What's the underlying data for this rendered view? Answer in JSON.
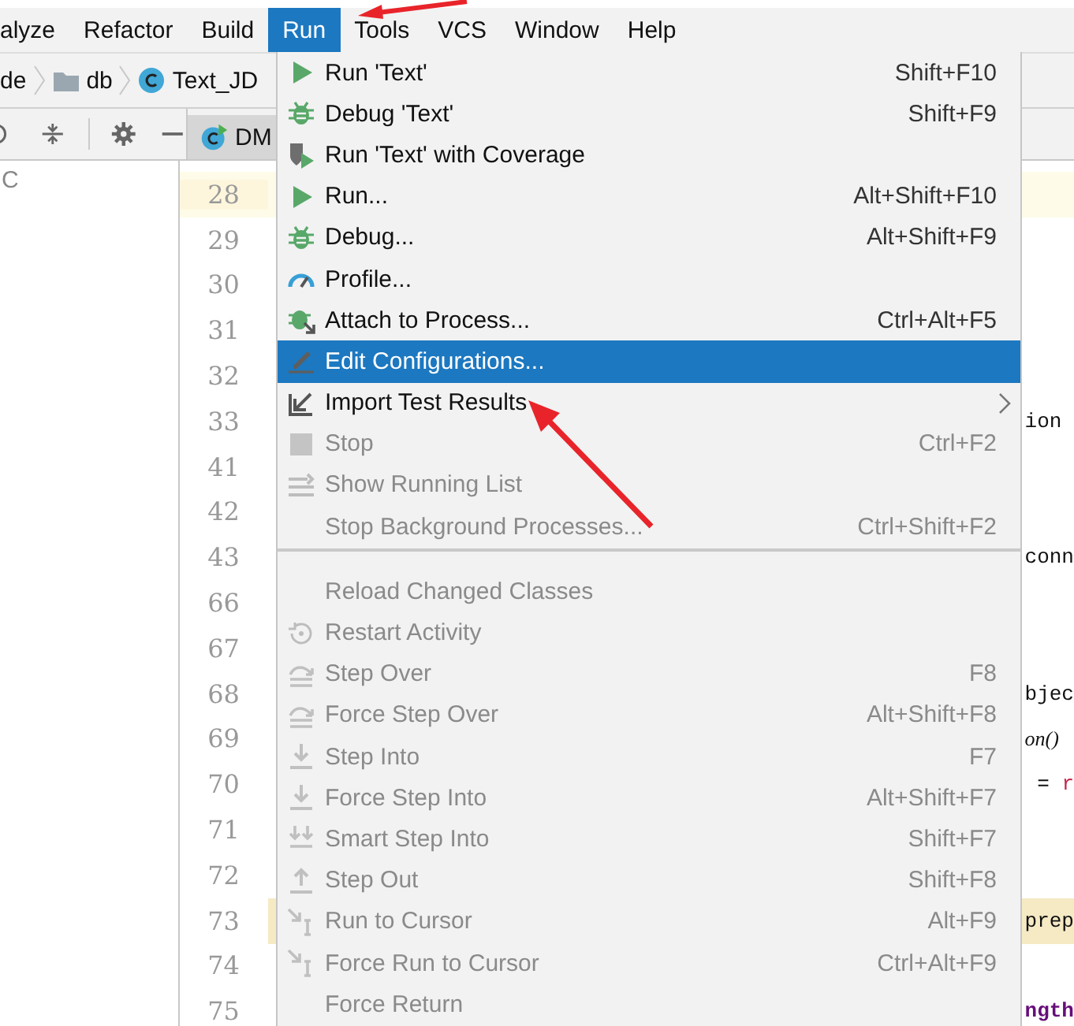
{
  "menubar": [
    {
      "label": "alyze",
      "selected": false
    },
    {
      "label": "Refactor",
      "selected": false
    },
    {
      "label": "Build",
      "selected": false
    },
    {
      "label": "Run",
      "selected": true
    },
    {
      "label": "Tools",
      "selected": false
    },
    {
      "label": "VCS",
      "selected": false
    },
    {
      "label": "Window",
      "selected": false
    },
    {
      "label": "Help",
      "selected": false
    }
  ],
  "breadcrumb": [
    {
      "label": "de",
      "kind": "text"
    },
    {
      "label": "db",
      "kind": "folder"
    },
    {
      "label": "Text_JD",
      "kind": "class"
    }
  ],
  "editor_tab": {
    "label": "DM"
  },
  "project_panel": {
    "label": "C"
  },
  "lines": [
    {
      "number": "28",
      "current": true,
      "highlighted": false
    },
    {
      "number": "29",
      "current": false,
      "highlighted": false
    },
    {
      "number": "30",
      "current": false,
      "highlighted": false
    },
    {
      "number": "31",
      "current": false,
      "highlighted": false
    },
    {
      "number": "32",
      "current": false,
      "highlighted": false
    },
    {
      "number": "33",
      "current": false,
      "highlighted": false,
      "segments": [
        {
          "text": "ion",
          "kind": "plain"
        }
      ]
    },
    {
      "number": "41",
      "current": false,
      "highlighted": false
    },
    {
      "number": "42",
      "current": false,
      "highlighted": false
    },
    {
      "number": "43",
      "current": false,
      "highlighted": false,
      "segments": [
        {
          "text": "conn",
          "kind": "plain"
        }
      ]
    },
    {
      "number": "66",
      "current": false,
      "highlighted": false
    },
    {
      "number": "67",
      "current": false,
      "highlighted": false
    },
    {
      "number": "68",
      "current": false,
      "highlighted": false,
      "segments": [
        {
          "text": "bjec",
          "kind": "plain"
        }
      ]
    },
    {
      "number": "69",
      "current": false,
      "highlighted": false,
      "segments": [
        {
          "text": "on()",
          "kind": "method"
        }
      ]
    },
    {
      "number": "70",
      "current": false,
      "highlighted": false,
      "segments": [
        {
          "text": " = ",
          "kind": "plain"
        },
        {
          "text": "r",
          "kind": "keyword"
        }
      ]
    },
    {
      "number": "71",
      "current": false,
      "highlighted": false
    },
    {
      "number": "72",
      "current": false,
      "highlighted": false
    },
    {
      "number": "73",
      "current": false,
      "highlighted": true,
      "segments": [
        {
          "text": "prep",
          "kind": "plain"
        }
      ]
    },
    {
      "number": "74",
      "current": false,
      "highlighted": false
    },
    {
      "number": "75",
      "current": false,
      "highlighted": false,
      "segments": [
        {
          "text": "ngth",
          "kind": "field"
        }
      ]
    }
  ],
  "menu": {
    "items": [
      {
        "kind": "action",
        "label": "Run 'Text'",
        "shortcut": "Shift+F10",
        "disabled": false,
        "selected": false
      },
      {
        "kind": "action",
        "label": "Debug 'Text'",
        "shortcut": "Shift+F9",
        "disabled": false,
        "selected": false
      },
      {
        "kind": "action",
        "label": "Run 'Text' with Coverage",
        "disabled": false,
        "selected": false
      },
      {
        "kind": "action",
        "label": "Run...",
        "shortcut": "Alt+Shift+F10",
        "disabled": false,
        "selected": false
      },
      {
        "kind": "action",
        "label": "Debug...",
        "shortcut": "Alt+Shift+F9",
        "disabled": false,
        "selected": false
      },
      {
        "kind": "action",
        "label": "Profile...",
        "disabled": false,
        "selected": false
      },
      {
        "kind": "action",
        "label": "Attach to Process...",
        "shortcut": "Ctrl+Alt+F5",
        "disabled": false,
        "selected": false
      },
      {
        "kind": "action",
        "label": "Edit Configurations...",
        "disabled": false,
        "selected": true
      },
      {
        "kind": "submenu",
        "label": "Import Test Results",
        "disabled": false,
        "selected": false
      },
      {
        "kind": "action",
        "label": "Stop",
        "shortcut": "Ctrl+F2",
        "disabled": true,
        "selected": false
      },
      {
        "kind": "action",
        "label": "Show Running List",
        "disabled": true,
        "selected": false
      },
      {
        "kind": "action",
        "label": "Stop Background Processes...",
        "shortcut": "Ctrl+Shift+F2",
        "disabled": true,
        "selected": false
      },
      {
        "kind": "separator"
      },
      {
        "kind": "action",
        "label": "Reload Changed Classes",
        "disabled": true,
        "selected": false
      },
      {
        "kind": "action",
        "label": "Restart Activity",
        "disabled": true,
        "selected": false
      },
      {
        "kind": "action",
        "label": "Step Over",
        "shortcut": "F8",
        "disabled": true,
        "selected": false
      },
      {
        "kind": "action",
        "label": "Force Step Over",
        "shortcut": "Alt+Shift+F8",
        "disabled": true,
        "selected": false
      },
      {
        "kind": "action",
        "label": "Step Into",
        "shortcut": "F7",
        "disabled": true,
        "selected": false
      },
      {
        "kind": "action",
        "label": "Force Step Into",
        "shortcut": "Alt+Shift+F7",
        "disabled": true,
        "selected": false
      },
      {
        "kind": "action",
        "label": "Smart Step Into",
        "shortcut": "Shift+F7",
        "disabled": true,
        "selected": false
      },
      {
        "kind": "action",
        "label": "Step Out",
        "shortcut": "Shift+F8",
        "disabled": true,
        "selected": false
      },
      {
        "kind": "action",
        "label": "Run to Cursor",
        "shortcut": "Alt+F9",
        "disabled": true,
        "selected": false
      },
      {
        "kind": "action",
        "label": "Force Run to Cursor",
        "shortcut": "Ctrl+Alt+F9",
        "disabled": true,
        "selected": false
      },
      {
        "kind": "action",
        "label": "Force Return",
        "disabled": true,
        "selected": false
      }
    ]
  }
}
